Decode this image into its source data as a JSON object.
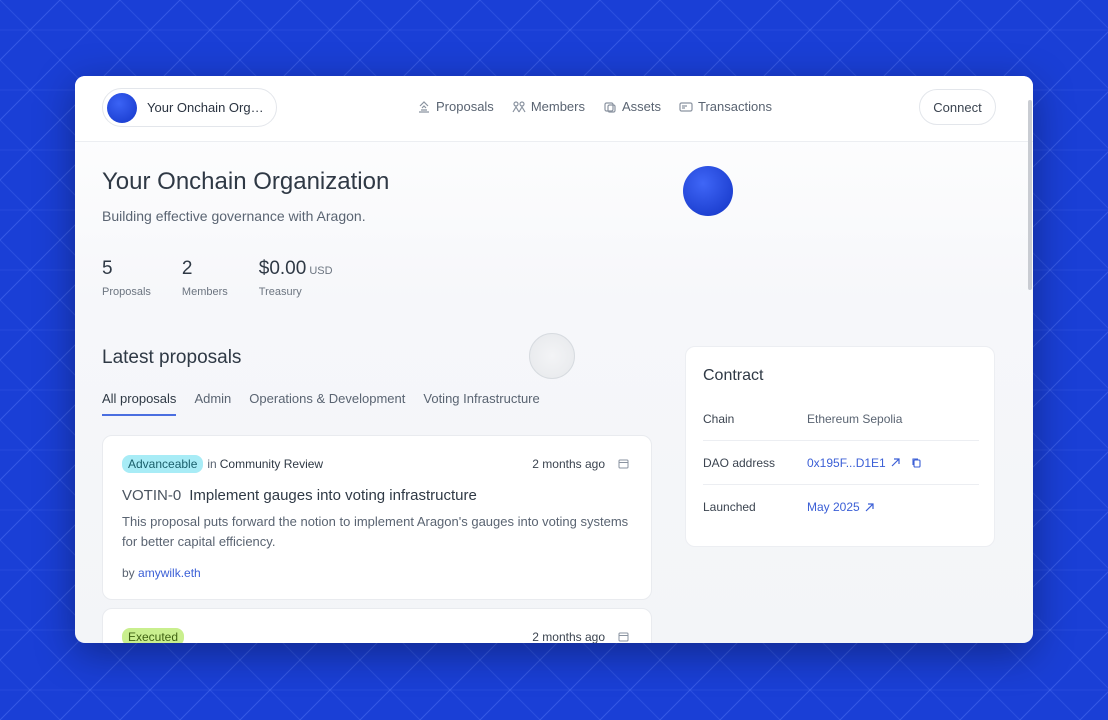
{
  "org": {
    "short_name": "Your Onchain Orga...",
    "name": "Your Onchain Organization",
    "tagline": "Building effective governance with Aragon."
  },
  "nav": {
    "links": [
      {
        "label": "Proposals",
        "icon": "gavel-icon"
      },
      {
        "label": "Members",
        "icon": "members-icon"
      },
      {
        "label": "Assets",
        "icon": "coins-icon"
      },
      {
        "label": "Transactions",
        "icon": "transactions-icon"
      }
    ],
    "connect_label": "Connect"
  },
  "stats": [
    {
      "value": "5",
      "unit": "",
      "label": "Proposals"
    },
    {
      "value": "2",
      "unit": "",
      "label": "Members"
    },
    {
      "value": "$0.00",
      "unit": "USD",
      "label": "Treasury"
    }
  ],
  "proposals": {
    "title": "Latest proposals",
    "tabs": [
      "All proposals",
      "Admin",
      "Operations & Development",
      "Voting Infrastructure"
    ],
    "active_tab": 0,
    "items": [
      {
        "status": "Advanceable",
        "in": "in",
        "stage": "Community Review",
        "date": "2 months ago",
        "id": "VOTIN-0",
        "title": "Implement gauges into voting infrastructure",
        "description": "This proposal puts forward the notion to implement Aragon's gauges into voting systems for better capital efficiency.",
        "by": "by",
        "author": "amywilk.eth"
      },
      {
        "status": "Executed",
        "date": "2 months ago"
      }
    ]
  },
  "contract": {
    "title": "Contract",
    "rows": [
      {
        "key": "Chain",
        "value": "Ethereum Sepolia"
      },
      {
        "key": "DAO address",
        "value": "0x195F...D1E1"
      },
      {
        "key": "Launched",
        "value": "May 2025"
      }
    ]
  },
  "colors": {
    "background": "#1a3fd6",
    "accent": "#3b5fd6",
    "advanceable_badge": "#a8ecf6",
    "executed_badge": "#c9ef8e"
  }
}
